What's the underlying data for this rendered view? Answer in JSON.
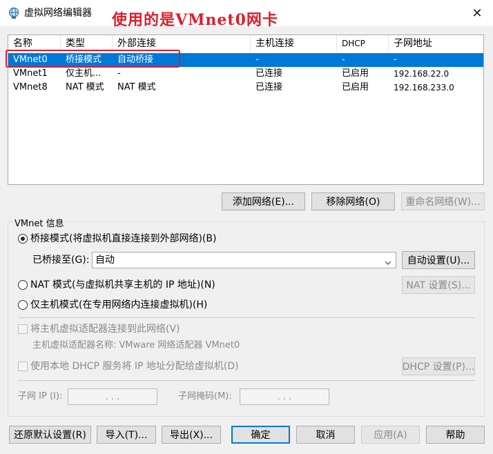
{
  "window": {
    "title": "虚拟网络编辑器",
    "close_glyph": "✕"
  },
  "annotation": {
    "text": "使用的是VMnet0网卡",
    "color": "#e11b2a"
  },
  "table": {
    "columns": [
      "名称",
      "类型",
      "外部连接",
      "主机连接",
      "DHCP",
      "子网地址"
    ],
    "rows": [
      {
        "name": "VMnet0",
        "type": "桥接模式",
        "external": "自动桥接",
        "host": "-",
        "dhcp": "-",
        "subnet": "-",
        "selected": true
      },
      {
        "name": "VMnet1",
        "type": "仅主机...",
        "external": "-",
        "host": "已连接",
        "dhcp": "已启用",
        "subnet": "192.168.22.0",
        "selected": false
      },
      {
        "name": "VMnet8",
        "type": "NAT 模式",
        "external": "NAT 模式",
        "host": "已连接",
        "dhcp": "已启用",
        "subnet": "192.168.233.0",
        "selected": false
      }
    ]
  },
  "table_buttons": {
    "add": "添加网络(E)...",
    "remove": "移除网络(O)",
    "rename": "重命名网络(W)..."
  },
  "vmnet_info": {
    "legend": "VMnet 信息",
    "bridged_radio": "桥接模式(将虚拟机直接连接到外部网络)(B)",
    "bridged_to_label": "已桥接至(G):",
    "bridged_to_value": "自动",
    "auto_settings_button": "自动设置(U)...",
    "nat_radio": "NAT 模式(与虚拟机共享主机的 IP 地址)(N)",
    "nat_settings_button": "NAT 设置(S)...",
    "hostonly_radio": "仅主机模式(在专用网络内连接虚拟机)(H)",
    "connect_adapter_checkbox": "将主机虚拟适配器连接到此网络(V)",
    "adapter_name_text": "主机虚拟适配器名称: VMware 网络适配器 VMnet0",
    "dhcp_checkbox": "使用本地 DHCP 服务将 IP 地址分配给虚拟机(D)",
    "dhcp_settings_button": "DHCP 设置(P)...",
    "subnet_ip_label": "子网 IP (I):",
    "subnet_mask_label": "子网掩码(M):",
    "ip_placeholder_dots": ".     .     ."
  },
  "bottom_buttons": {
    "restore": "还原默认设置(R)",
    "import": "导入(T)...",
    "export": "导出(X)...",
    "ok": "确定",
    "cancel": "取消",
    "apply": "应用(A)",
    "help": "帮助"
  },
  "colors": {
    "selection": "#0078d7",
    "annotation": "#e11b2a",
    "window_bg": "#f0f0f0"
  }
}
